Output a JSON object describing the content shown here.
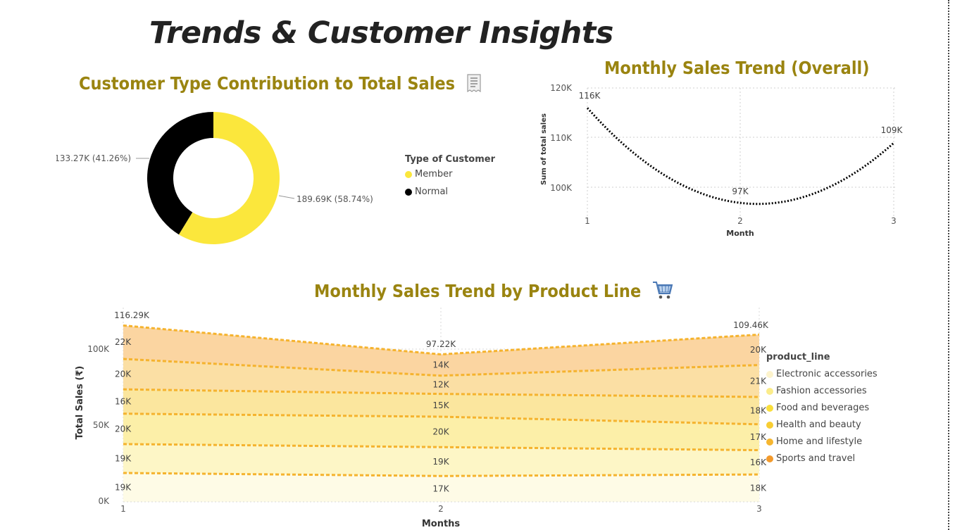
{
  "page": {
    "title": "Trends & Customer Insights"
  },
  "donut": {
    "title": "Customer Type Contribution to Total Sales",
    "icon": "receipt-icon",
    "legend_title": "Type of Customer",
    "label_member": "189.69K (58.74%)",
    "label_normal": "133.27K (41.26%)"
  },
  "line": {
    "title": "Monthly Sales Trend (Overall)",
    "label_m1": "116K",
    "label_m2": "97K",
    "label_m3": "109K"
  },
  "area": {
    "title": "Monthly Sales Trend by Product Line",
    "icon": "shopping-cart-icon",
    "legend_title": "product_line",
    "total_m1": "116.29K",
    "total_m2": "97.22K",
    "total_m3": "109.46K"
  },
  "colors": {
    "member": "#fbe73c",
    "normal": "#000000",
    "title": "#9a8410",
    "series_line": "#f5b32e"
  },
  "chart_data": [
    {
      "type": "pie",
      "title": "Customer Type Contribution to Total Sales",
      "legend_title": "Type of Customer",
      "legend_position": "right",
      "categories": [
        "Member",
        "Normal"
      ],
      "values": [
        189.69,
        133.27
      ],
      "value_labels": [
        "189.69K (58.74%)",
        "133.27K (41.26%)"
      ],
      "colors": [
        "#fbe73c",
        "#000000"
      ]
    },
    {
      "type": "line",
      "title": "Monthly Sales Trend (Overall)",
      "xlabel": "Month",
      "ylabel": "Sum of total sales",
      "x": [
        1,
        2,
        3
      ],
      "values": [
        116,
        97,
        109
      ],
      "data_labels": [
        "116K",
        "97K",
        "109K"
      ],
      "yticks": [
        "100K",
        "110K",
        "120K"
      ],
      "ylim": [
        95,
        120
      ],
      "grid": true
    },
    {
      "type": "area",
      "title": "Monthly Sales Trend by Product Line",
      "xlabel": "Months",
      "ylabel": "Total Sales (₹)",
      "x": [
        1,
        2,
        3
      ],
      "yticks": [
        "0K",
        "50K",
        "100K"
      ],
      "ylim": [
        0,
        120
      ],
      "stacked": true,
      "legend_title": "product_line",
      "legend_position": "right",
      "totals": [
        "116.29K",
        "97.22K",
        "109.46K"
      ],
      "series": [
        {
          "name": "Sports and travel",
          "values": [
            19,
            17,
            18
          ],
          "labels": [
            "19K",
            "17K",
            "18K"
          ],
          "color": "#fefbe6"
        },
        {
          "name": "Home and lifestyle",
          "values": [
            19,
            19,
            16
          ],
          "labels": [
            "19K",
            "19K",
            "16K"
          ],
          "color": "#fdf6c6"
        },
        {
          "name": "Health and beauty",
          "values": [
            20,
            20,
            17
          ],
          "labels": [
            "20K",
            "20K",
            "17K"
          ],
          "color": "#fcefa8"
        },
        {
          "name": "Food and beverages",
          "values": [
            16,
            15,
            18
          ],
          "labels": [
            "16K",
            "15K",
            "18K"
          ],
          "color": "#fbe69e"
        },
        {
          "name": "Fashion accessories",
          "values": [
            20,
            12,
            21
          ],
          "labels": [
            "20K",
            "12K",
            "21K"
          ],
          "color": "#fbdfa4"
        },
        {
          "name": "Electronic accessories",
          "values": [
            22,
            14,
            20
          ],
          "labels": [
            "22K",
            "14K",
            "20K"
          ],
          "color": "#fbd5a1"
        }
      ],
      "legend": [
        {
          "name": "Electronic accessories",
          "color": "#fdf3cc"
        },
        {
          "name": "Fashion accessories",
          "color": "#fbec8a"
        },
        {
          "name": "Food and beverages",
          "color": "#f9de3b"
        },
        {
          "name": "Health and beauty",
          "color": "#f8cd33"
        },
        {
          "name": "Home and lifestyle",
          "color": "#f6b630"
        },
        {
          "name": "Sports and travel",
          "color": "#f39a2c"
        }
      ]
    }
  ]
}
